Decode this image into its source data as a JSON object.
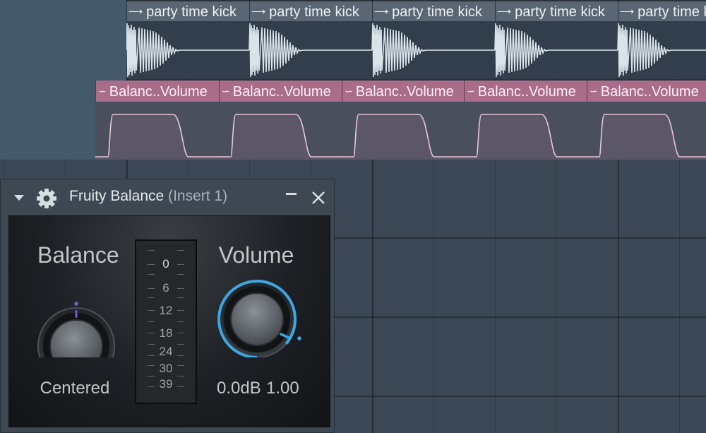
{
  "playlist": {
    "audio_clips": [
      {
        "label": "party time kick"
      },
      {
        "label": "party time kick"
      },
      {
        "label": "party time kick"
      },
      {
        "label": "party time kick"
      },
      {
        "label": "party time kick"
      }
    ],
    "automation_clips": [
      {
        "label": "Balanc..Volume"
      },
      {
        "label": "Balanc..Volume"
      },
      {
        "label": "Balanc..Volume"
      },
      {
        "label": "Balanc..Volume"
      },
      {
        "label": "Balanc..Volume"
      }
    ]
  },
  "plugin": {
    "title": "Fruity Balance",
    "subtitle": "(Insert 1)",
    "balance": {
      "label": "Balance",
      "value_text": "Centered"
    },
    "volume": {
      "label": "Volume",
      "db_text": "0.0dB",
      "gain_text": "1.00"
    },
    "scale": [
      "0",
      "6",
      "12",
      "18",
      "24",
      "30",
      "39"
    ],
    "icons": [
      "collapse-arrow-icon",
      "gear-icon",
      "minimize-icon",
      "close-icon"
    ]
  },
  "colors": {
    "audio_clip_header": "#5a6673",
    "automation_clip_header": "#a96d8a",
    "volume_ring": "#3ea6e0",
    "balance_marker": "#7d5cc9"
  }
}
